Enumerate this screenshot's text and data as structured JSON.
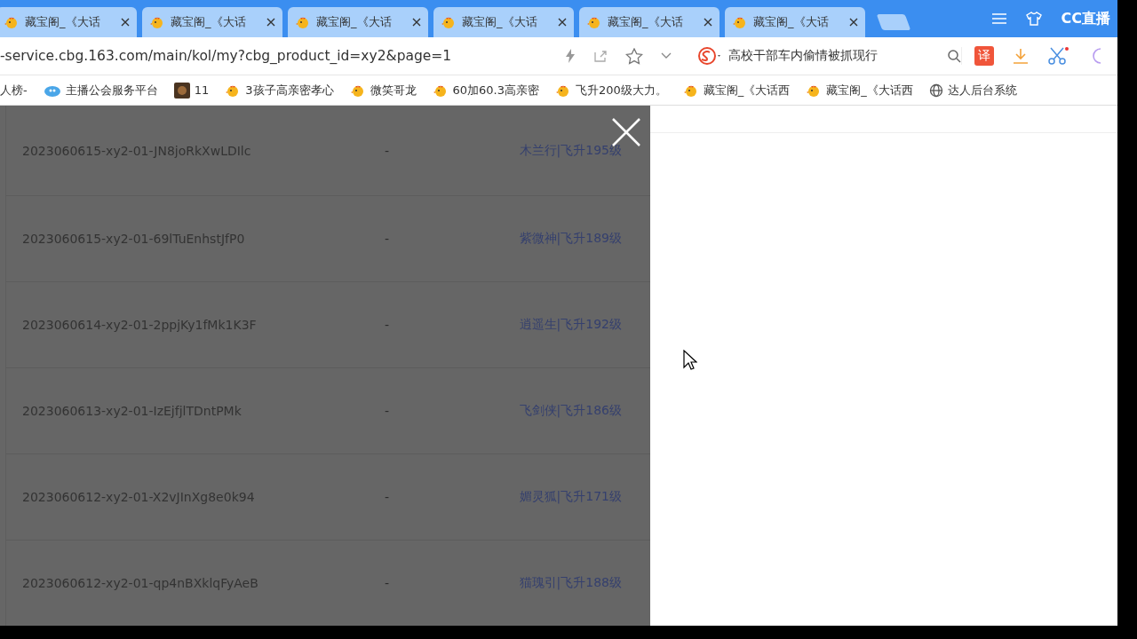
{
  "tabs": [
    {
      "title": "藏宝阁_《大话",
      "selected": false
    },
    {
      "title": "藏宝阁_《大话",
      "selected": false
    },
    {
      "title": "藏宝阁_《大话",
      "selected": false
    },
    {
      "title": "藏宝阁_《大话",
      "selected": false
    },
    {
      "title": "藏宝阁_《大话",
      "selected": false
    },
    {
      "title": "藏宝阁_《大话",
      "selected": false
    }
  ],
  "brand": "CC直播",
  "address": "-service.cbg.163.com/main/kol/my?cbg_product_id=xy2&page=1",
  "search": {
    "value": "高校干部车内偷情被抓现行"
  },
  "translate": "译",
  "bookmarks": [
    {
      "label": "人榜-",
      "kind": "none"
    },
    {
      "label": "主播公会服务平台",
      "kind": "cloud"
    },
    {
      "label": "11",
      "kind": "game"
    },
    {
      "label": "3孩子高亲密孝心",
      "kind": "chick"
    },
    {
      "label": "微笑哥龙",
      "kind": "chick"
    },
    {
      "label": "60加60.3高亲密",
      "kind": "chick"
    },
    {
      "label": "飞升200级大力。",
      "kind": "chick"
    },
    {
      "label": "藏宝阁_《大话西",
      "kind": "chick"
    },
    {
      "label": "藏宝阁_《大话西",
      "kind": "chick"
    },
    {
      "label": "达人后台系统",
      "kind": "globe"
    }
  ],
  "rows": [
    {
      "id": "2023060615-xy2-01-JN8joRkXwLDIlc",
      "status": "-",
      "role": "木兰行|飞升195级"
    },
    {
      "id": "2023060615-xy2-01-69lTuEnhstJfP0",
      "status": "-",
      "role": "紫微神|飞升189级"
    },
    {
      "id": "2023060614-xy2-01-2ppjKy1fMk1K3F",
      "status": "-",
      "role": "逍遥生|飞升192级"
    },
    {
      "id": "2023060613-xy2-01-IzEjfjlTDntPMk",
      "status": "-",
      "role": "飞剑侠|飞升186级"
    },
    {
      "id": "2023060612-xy2-01-X2vJInXg8e0k94",
      "status": "-",
      "role": "媚灵狐|飞升171级"
    },
    {
      "id": "2023060612-xy2-01-qp4nBXklqFyAeB",
      "status": "-",
      "role": "猫瑰引|飞升188级"
    }
  ]
}
